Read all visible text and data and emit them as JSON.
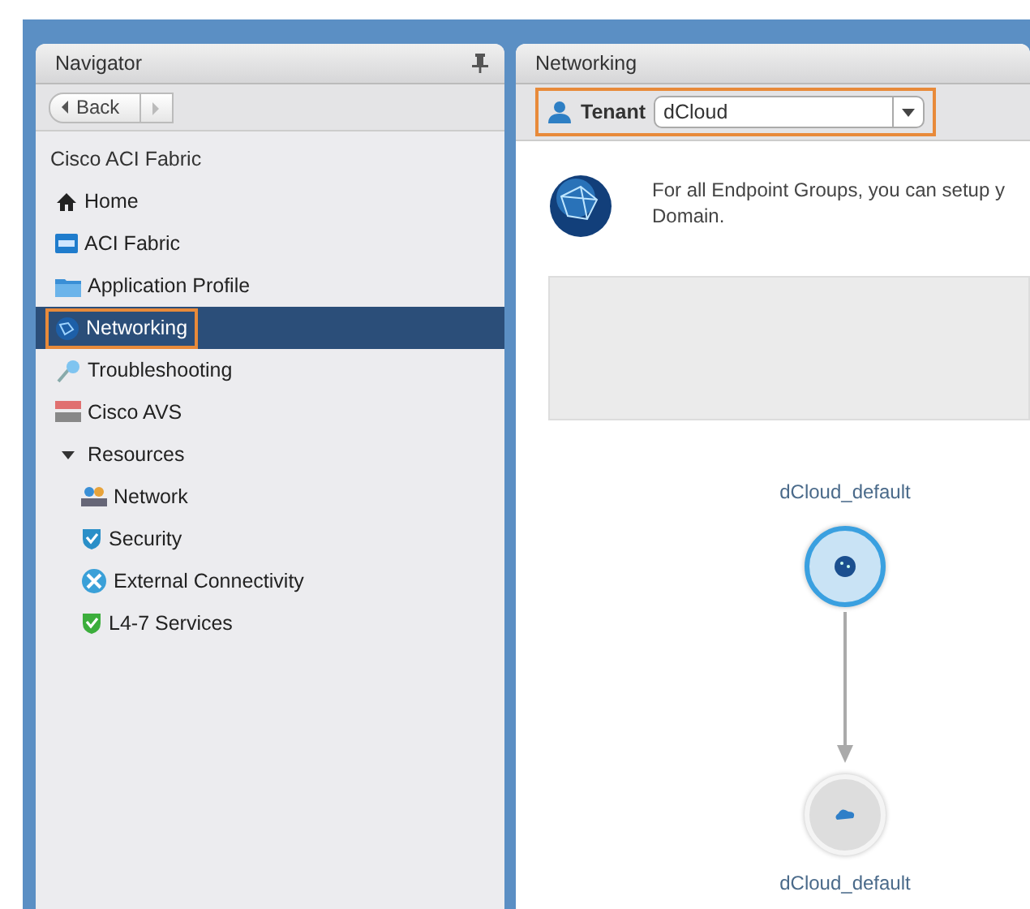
{
  "navigator": {
    "title": "Navigator",
    "back": "Back",
    "section": "Cisco ACI Fabric",
    "items": [
      {
        "label": "Home",
        "selected": false,
        "outlined": false
      },
      {
        "label": "ACI Fabric",
        "selected": false,
        "outlined": false
      },
      {
        "label": "Application Profile",
        "selected": false,
        "outlined": false
      },
      {
        "label": "Networking",
        "selected": true,
        "outlined": true
      },
      {
        "label": "Troubleshooting",
        "selected": false,
        "outlined": false
      },
      {
        "label": "Cisco AVS",
        "selected": false,
        "outlined": false
      },
      {
        "label": "Resources",
        "selected": false,
        "outlined": false,
        "expanded": true,
        "children": [
          {
            "label": "Network",
            "selected": false
          },
          {
            "label": "Security",
            "selected": false
          },
          {
            "label": "External Connectivity",
            "selected": false
          },
          {
            "label": "L4-7 Services",
            "selected": false
          }
        ]
      }
    ]
  },
  "main": {
    "title": "Networking",
    "tenant": {
      "label": "Tenant",
      "value": "dCloud",
      "outlined": true
    },
    "description": [
      "For all Endpoint Groups, you can setup y",
      "Domain."
    ],
    "nodes": [
      {
        "label": "dCloud_default",
        "selected": true
      },
      {
        "label": "dCloud_default",
        "selected": false
      }
    ]
  }
}
